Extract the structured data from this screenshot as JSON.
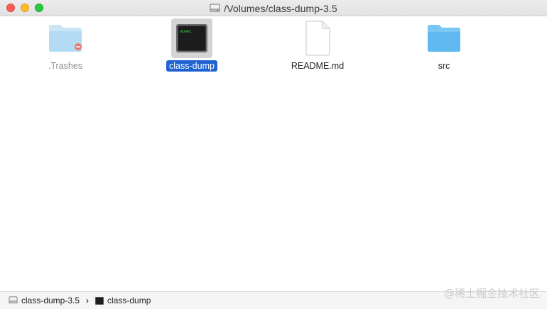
{
  "window": {
    "title": "/Volumes/class-dump-3.5"
  },
  "files": [
    {
      "name": ".Trashes",
      "kind": "folder-hidden",
      "selected": false
    },
    {
      "name": "class-dump",
      "kind": "executable",
      "selected": true
    },
    {
      "name": "README.md",
      "kind": "document",
      "selected": false
    },
    {
      "name": "src",
      "kind": "folder",
      "selected": false
    }
  ],
  "exec_icon_text": "exec",
  "pathbar": {
    "segments": [
      "class-dump-3.5",
      "class-dump"
    ],
    "separator": "›"
  },
  "watermark": "@稀土掘金技术社区",
  "colors": {
    "selection": "#1f63d1",
    "folder": "#5fb8f0",
    "close": "#fc5f57",
    "minimize": "#fdbc2e",
    "maximize": "#28c840"
  }
}
